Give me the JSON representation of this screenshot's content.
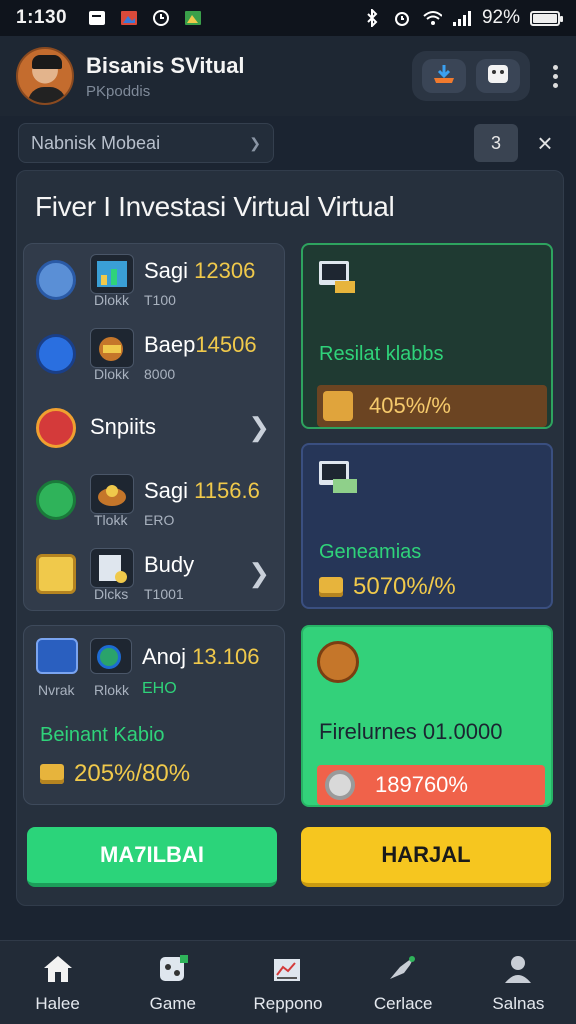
{
  "status_bar": {
    "time": "1:130",
    "battery_text": "92%",
    "battery_level": 0.92,
    "icons": [
      "notification-icon",
      "gallery-icon",
      "clock-icon",
      "app-icon",
      "bluetooth-icon",
      "alarm-icon",
      "wifi-icon",
      "signal-icon",
      "battery-icon"
    ]
  },
  "header": {
    "title": "Bisanis SVitual",
    "subtitle": "PKpoddis",
    "actions": [
      "download-icon",
      "game-icon"
    ]
  },
  "search": {
    "value": "Nabnisk Mobeai",
    "counter": "3"
  },
  "panel": {
    "title": "Fiver I Investasi Virtual Virtual"
  },
  "list": [
    {
      "name": "Sagi",
      "value_hl": "12306",
      "tag": "Dlokk",
      "val": "T100"
    },
    {
      "name": "Baep",
      "value_hl": "14506",
      "tag": "Dlokk",
      "val": "8000"
    },
    {
      "name": "Snpiits",
      "value_hl": "",
      "tag": "",
      "val": ""
    },
    {
      "name": "Sagi",
      "value_hl": "1156.6",
      "tag": "Tlokk",
      "val": "ERO"
    },
    {
      "name": "Budy",
      "value_hl": "",
      "tag": "Dlcks",
      "val": "T1001"
    }
  ],
  "small_card": {
    "name": "Anoj",
    "value_hl": "13.106",
    "tag1": "Nvrak",
    "tag2": "Rlokk",
    "val": "EHO",
    "sub": "Beinant Kabio",
    "pct": "205%/80%"
  },
  "tiles": {
    "a": {
      "label": "Resilat klabbs",
      "bar": "405%/%"
    },
    "b": {
      "label": "Geneamias",
      "pct": "5070%/%"
    },
    "c": {
      "label": "Firelurnes 01.0000",
      "bar": "189760%"
    }
  },
  "buttons": {
    "primary": "MA7ILBAI",
    "secondary": "HARJAL"
  },
  "nav": [
    {
      "label": "Halee",
      "icon": "home-icon"
    },
    {
      "label": "Game",
      "icon": "game-icon"
    },
    {
      "label": "Reppono",
      "icon": "report-icon"
    },
    {
      "label": "Cerlace",
      "icon": "rocket-icon"
    },
    {
      "label": "Salnas",
      "icon": "profile-icon"
    }
  ],
  "colors": {
    "accent_green": "#2bd47a",
    "accent_yellow": "#f6c61f",
    "highlight_gold": "#f0c94b",
    "background": "#1b2431"
  }
}
